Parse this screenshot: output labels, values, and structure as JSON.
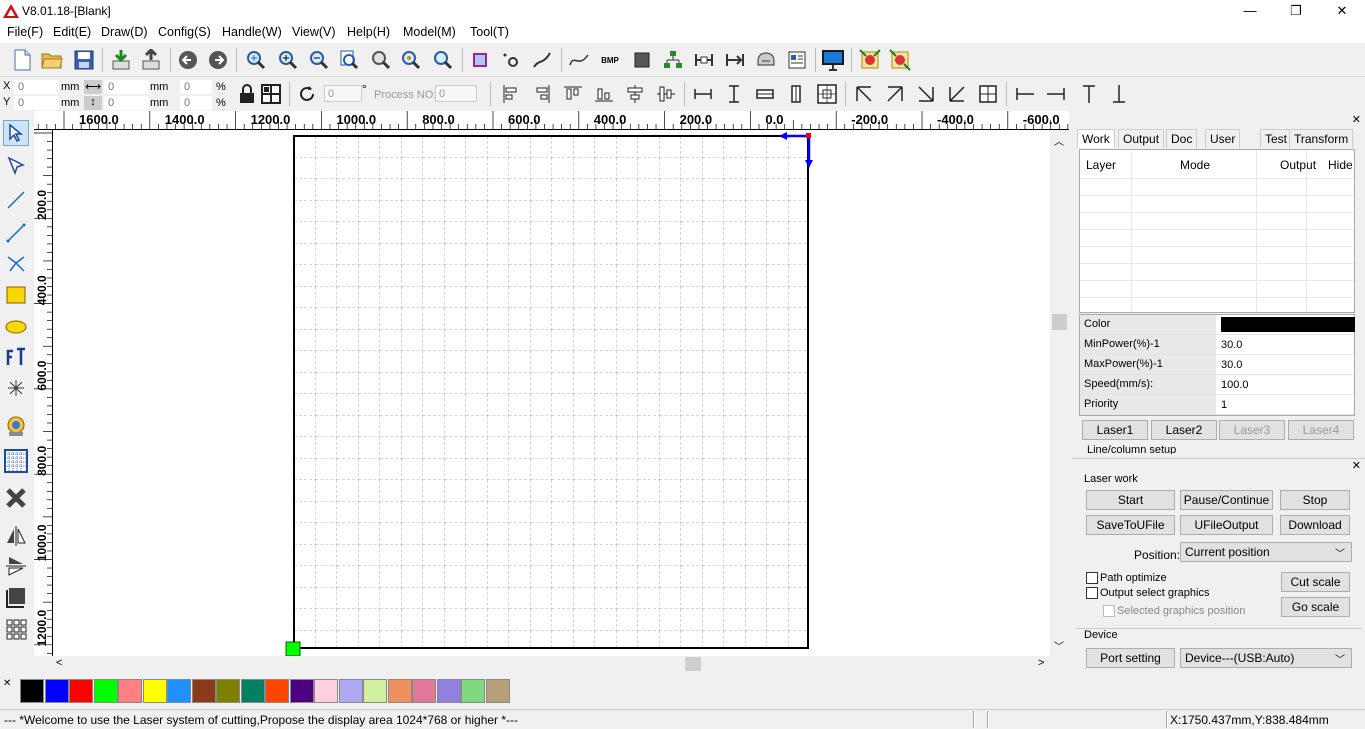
{
  "window": {
    "title": "V8.01.18-[Blank]",
    "minimize": "—",
    "maximize": "❐",
    "close": "✕"
  },
  "menu": [
    "File(F)",
    "Edit(E)",
    "Draw(D)",
    "Config(S)",
    "Handle(W)",
    "View(V)",
    "Help(H)",
    "Model(M)",
    "Tool(T)"
  ],
  "toolbar2": {
    "x_label": "X",
    "y_label": "Y",
    "x_value": "0",
    "y_value": "0",
    "unit": "mm",
    "w_value": "0",
    "h_value": "0",
    "px_value": "0",
    "py_value": "0",
    "pct": "%",
    "rotate_value": "0",
    "degree": "°",
    "process_no_label": "Process NO:",
    "process_no_value": "0"
  },
  "hruler": [
    "1600.0",
    "1400.0",
    "1200.0",
    "1000.0",
    "800.0",
    "600.0",
    "400.0",
    "200.0",
    "0.0",
    "-200.0",
    "-400.0",
    "-600.0"
  ],
  "vruler": [
    "200.0",
    "400.0",
    "600.0",
    "800.0",
    "1000.0",
    "1200.0"
  ],
  "palette": [
    "#000000",
    "#0000ff",
    "#ff0000",
    "#00ff00",
    "#ff8080",
    "#ffff00",
    "#1e90ff",
    "#8b3a1a",
    "#808000",
    "#008060",
    "#ff4500",
    "#4b0082",
    "#ffd0e0",
    "#b0a8f0",
    "#d0f0a0",
    "#f09060",
    "#e07898",
    "#9080e0",
    "#80d880",
    "#b8a078"
  ],
  "tabs": [
    "Work",
    "Output",
    "Doc",
    "User",
    "Test",
    "Transform"
  ],
  "layer_table": {
    "headers": [
      "Layer",
      "Mode",
      "Output",
      "Hide"
    ]
  },
  "props": [
    {
      "key": "Color",
      "value": ""
    },
    {
      "key": "MinPower(%)-1",
      "value": "30.0"
    },
    {
      "key": "MaxPower(%)-1",
      "value": "30.0"
    },
    {
      "key": "Speed(mm/s):",
      "value": "100.0"
    },
    {
      "key": "Priority",
      "value": "1"
    }
  ],
  "laser_buttons": [
    "Laser1",
    "Laser2",
    "Laser3",
    "Laser4"
  ],
  "line_column_setup": "Line/column setup",
  "laser_work": {
    "title": "Laser work",
    "start": "Start",
    "pause": "Pause/Continue",
    "stop": "Stop",
    "save_to_file": "SaveToUFile",
    "ufile_output": "UFileOutput",
    "download": "Download",
    "position_label": "Position:",
    "position_value": "Current position",
    "path_optimize": "Path optimize",
    "output_select": "Output select graphics",
    "selected_position": "Selected graphics position",
    "cut_scale": "Cut scale",
    "go_scale": "Go scale"
  },
  "device": {
    "title": "Device",
    "port_setting": "Port setting",
    "device_value": "Device---(USB:Auto)"
  },
  "status": {
    "message": "--- *Welcome to use the Laser system of cutting,Propose the display area 1024*768 or higher *---",
    "coords": "X:1750.437mm,Y:838.484mm"
  },
  "colors": {
    "selected_color": "#000000",
    "origin_marker": "#00ff00",
    "arrow": "#0000ff"
  }
}
